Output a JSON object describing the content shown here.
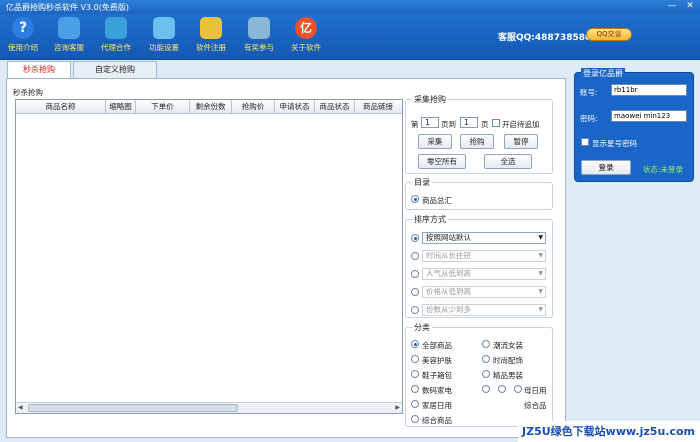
{
  "window": {
    "title": "亿品爵抢购秒杀软件 V3.0(免费版)",
    "minimize": "—",
    "close": "✕"
  },
  "toolbar": {
    "items": [
      {
        "label": "使用介绍",
        "icon": "help-icon",
        "color": "#2a7de1"
      },
      {
        "label": "咨询客服",
        "icon": "people-icon",
        "color": "#4aa0e8"
      },
      {
        "label": "代理合作",
        "icon": "network-icon",
        "color": "#39a0d8"
      },
      {
        "label": "功能设置",
        "icon": "monitor-icon",
        "color": "#6cc0ee"
      },
      {
        "label": "软件注册",
        "icon": "keys-icon",
        "color": "#e8c23a"
      },
      {
        "label": "有奖参与",
        "icon": "users-icon",
        "color": "#8ab6d8"
      },
      {
        "label": "关于软件",
        "icon": "logo-icon",
        "color": "#e8532e"
      }
    ],
    "service": "客服QQ:488738580",
    "qq_button": "QQ交谈"
  },
  "tabs": [
    "秒杀抢购",
    "自定义抢购"
  ],
  "left": {
    "group_label": "秒杀抢购",
    "columns": [
      "商品名称",
      "缩略图",
      "下单价",
      "剩余份数",
      "抢购价",
      "申请状态",
      "商品状态",
      "商品链接"
    ]
  },
  "collect": {
    "label": "采集抢购",
    "page_prefix": "第",
    "page_from": "1",
    "page_to_label": "页到",
    "page_to": "1",
    "page_suffix": "页",
    "enable_wait_label": "开启待追加",
    "buttons": {
      "collect": "采集",
      "buy": "抢购",
      "pause": "暂停",
      "clear": "零空所有",
      "select_all": "全选"
    }
  },
  "catalog": {
    "label": "目录",
    "item": "商品总汇"
  },
  "sort": {
    "label": "排序方式",
    "options": [
      "按照网站默认",
      "时间从长往短",
      "人气从低到高",
      "价格从低到高",
      "份数从少到多"
    ]
  },
  "category": {
    "label": "分类",
    "left": [
      "全部商品",
      "美容护肤",
      "鞋子箱包",
      "数码家电",
      "家居日用",
      "综合商品"
    ],
    "right": [
      "潮流女装",
      "时尚配饰",
      "精品男装",
      "母日用",
      "综合品"
    ]
  },
  "login": {
    "label": "登录亿品爵",
    "account_label": "账号:",
    "account_value": "rb11br",
    "password_label": "密码:",
    "password_value": "maowei min123",
    "show_password_label": "显示星号密码",
    "login_button": "登录",
    "status": "状态:未登录"
  },
  "watermark": "JZ5U绿色下载站www.jz5u.com"
}
